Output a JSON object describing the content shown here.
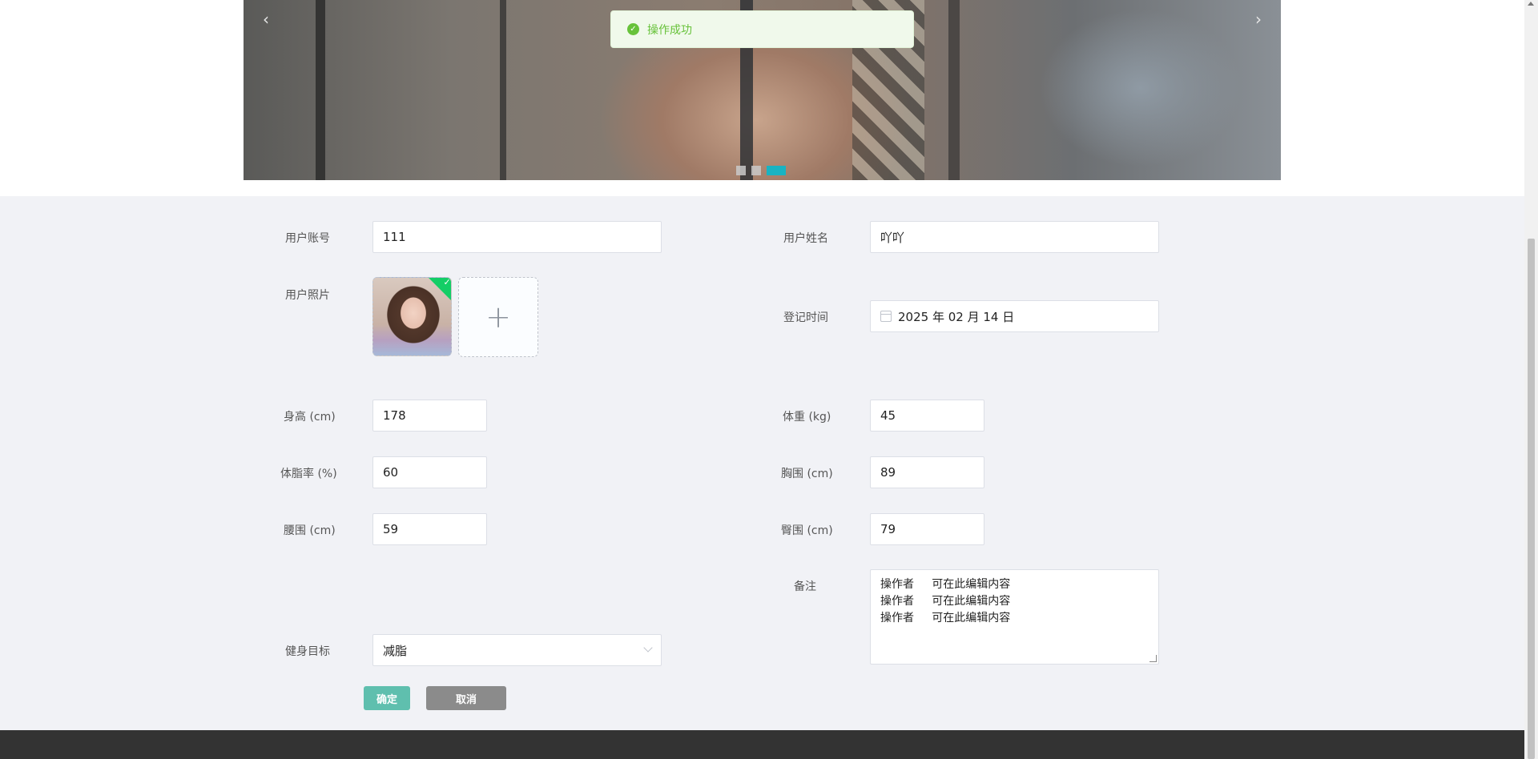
{
  "toast": {
    "message": "操作成功"
  },
  "carousel": {
    "prev": "‹",
    "next": "›",
    "dots": 3,
    "active_dot": 3
  },
  "form": {
    "account": {
      "label": "用户账号",
      "value": "111"
    },
    "name": {
      "label": "用户姓名",
      "value": "吖吖"
    },
    "photo": {
      "label": "用户照片",
      "add": "+"
    },
    "reg_time": {
      "label": "登记时间",
      "value": "2025 年 02 月 14 日"
    },
    "height": {
      "label": "身高 (cm)",
      "value": "178"
    },
    "weight": {
      "label": "体重 (kg)",
      "value": "45"
    },
    "bodyfat": {
      "label": "体脂率 (%)",
      "value": "60"
    },
    "chest": {
      "label": "胸围 (cm)",
      "value": "89"
    },
    "waist": {
      "label": "腰围 (cm)",
      "value": "59"
    },
    "hip": {
      "label": "臀围 (cm)",
      "value": "79"
    },
    "note": {
      "label": "备注",
      "lines": [
        "操作者     可在此编辑内容",
        "操作者     可在此编辑内容",
        "操作者     可在此编辑内容"
      ]
    },
    "goal": {
      "label": "健身目标",
      "value": "减脂"
    },
    "confirm_label": "确定",
    "cancel_label": "取消"
  },
  "colors": {
    "accent": "#19b3c2",
    "success": "#67c23a",
    "confirm": "#5fbfae",
    "cancel": "#8b8b8b",
    "footer": "#333333"
  }
}
